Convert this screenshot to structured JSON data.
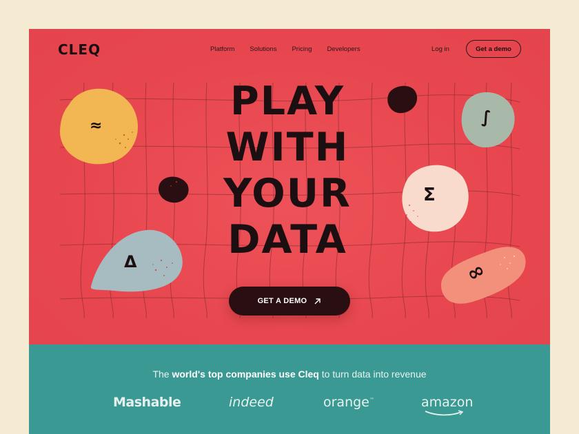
{
  "nav": {
    "logo": "CLEQ",
    "links": [
      "Platform",
      "Solutions",
      "Pricing",
      "Developers"
    ],
    "login": "Log in",
    "demo": "Get a demo"
  },
  "hero": {
    "headline": [
      "PLAY",
      "WITH",
      "YOUR",
      "DATA"
    ],
    "cta": "GET A DEMO",
    "cta_icon": "arrow-up-right-icon",
    "symbols": {
      "approx": "≈",
      "integral": "∫",
      "sigma": "Σ",
      "delta": "Δ",
      "infinity": "∞"
    }
  },
  "logos": {
    "tagline_pre": "The ",
    "tagline_bold1": "world's top companies use Cleq",
    "tagline_post": " to turn data into revenue",
    "brands": [
      "Mashable",
      "indeed",
      "orange",
      "amazon"
    ]
  },
  "colors": {
    "hero_bg": "#e8474f",
    "band_bg": "#3a9a93",
    "cta_bg": "#2a0f12",
    "page_bg": "#f5ead2"
  }
}
